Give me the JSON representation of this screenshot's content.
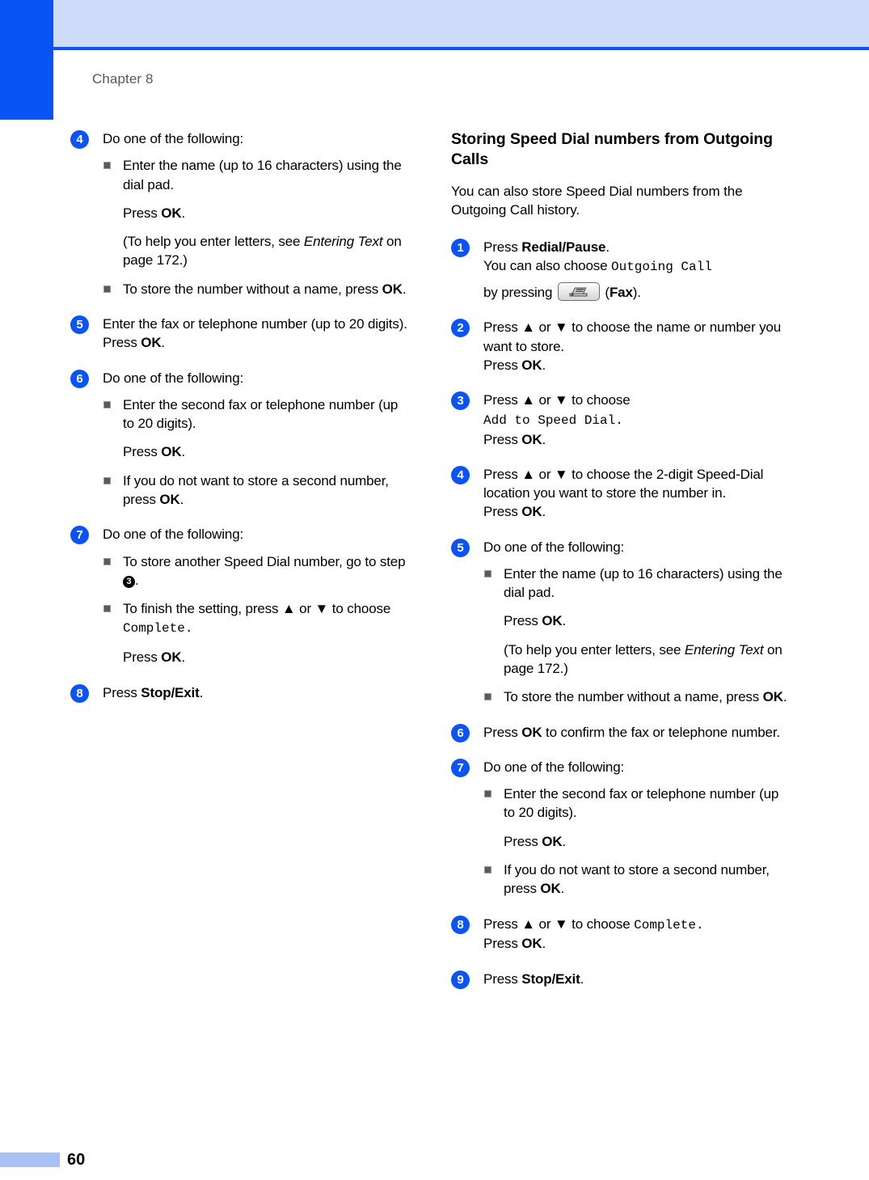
{
  "header": {
    "chapter_label": "Chapter 8"
  },
  "footer": {
    "page_number": "60"
  },
  "left_column": {
    "steps": [
      {
        "number": "4",
        "lines": [
          "Do one of the following:"
        ],
        "items": [
          {
            "kind": "bullet",
            "text_a": "Enter the name (up to 16 characters) using the dial pad."
          },
          {
            "kind": "para",
            "press": "Press ",
            "bold": "OK",
            "tail": "."
          },
          {
            "kind": "para",
            "text": " (To help you enter letters, see ",
            "italic": "Entering Text",
            "tail": " on page 172.)"
          },
          {
            "kind": "bullet",
            "text_a": "To store the number without a name, press ",
            "bold": "OK",
            "tail": "."
          }
        ]
      },
      {
        "number": "5",
        "lines": [
          "Enter the fax or telephone number (up to 20 digits)."
        ],
        "press_line": "Press ",
        "press_bold": "OK",
        "press_tail": "."
      },
      {
        "number": "6",
        "lines": [
          "Do one of the following:"
        ],
        "items": [
          {
            "kind": "bullet",
            "text_a": "Enter the second fax or telephone number (up to 20 digits)."
          },
          {
            "kind": "para",
            "press": "Press ",
            "bold": "OK",
            "tail": "."
          },
          {
            "kind": "bullet",
            "text_a": "If you do not want to store a second number, press ",
            "bold": "OK",
            "tail": "."
          }
        ]
      },
      {
        "number": "7",
        "lines": [
          "Do one of the following:"
        ],
        "items": [
          {
            "kind": "bullet_ref",
            "text_a": "To store another Speed Dial number, go to step ",
            "ref": "3",
            "tail": "."
          },
          {
            "kind": "bullet_lcd",
            "text_a": "To finish the setting, press ▲ or ▼ to choose ",
            "lcd": "Complete",
            "tail": "."
          },
          {
            "kind": "para",
            "press": "Press ",
            "bold": "OK",
            "tail": "."
          }
        ]
      },
      {
        "number": "8",
        "press_only": "Press ",
        "press_bold": "Stop/Exit",
        "press_tail": "."
      }
    ]
  },
  "right_column": {
    "heading": "Storing Speed Dial numbers from Outgoing Calls",
    "intro": "You can also store Speed Dial numbers from the Outgoing Call history.",
    "steps": [
      {
        "number": "1",
        "l1_press": "Press ",
        "l1_bold": "Redial/Pause",
        "l1_tail": ".",
        "l2_text": "You can also choose ",
        "l2_lcd": "Outgoing Call",
        "l3_text": "by pressing ",
        "l3_icon": "fax-machine-icon",
        "l3_paren_open": " (",
        "l3_bold": "Fax",
        "l3_paren_close": ")."
      },
      {
        "number": "2",
        "line1": "Press ▲ or ▼ to choose the name or number you want to store.",
        "press": "Press ",
        "press_bold": "OK",
        "press_tail": "."
      },
      {
        "number": "3",
        "line1": "Press ▲ or ▼ to choose",
        "lcd": "Add to Speed Dial",
        "lcd_tail": ".",
        "press": "Press ",
        "press_bold": "OK",
        "press_tail": "."
      },
      {
        "number": "4",
        "line1": "Press ▲ or ▼ to choose the 2-digit Speed-Dial location you want to store the number in.",
        "press": "Press ",
        "press_bold": "OK",
        "press_tail": "."
      },
      {
        "number": "5",
        "line1": "Do one of the following:",
        "items": [
          {
            "kind": "bullet",
            "text_a": "Enter the name (up to 16 characters) using the dial pad."
          },
          {
            "kind": "para",
            "press": "Press ",
            "bold": "OK",
            "tail": "."
          },
          {
            "kind": "para",
            "text": "(To help you enter letters, see ",
            "italic": "Entering Text",
            "tail": " on page 172.)"
          },
          {
            "kind": "bullet",
            "text_a": "To store the number without a name, press ",
            "bold": "OK",
            "tail": "."
          }
        ]
      },
      {
        "number": "6",
        "press": "Press ",
        "press_bold": "OK",
        "press_tail": " to confirm the fax or telephone number."
      },
      {
        "number": "7",
        "line1": "Do one of the following:",
        "items": [
          {
            "kind": "bullet",
            "text_a": "Enter the second fax or telephone number (up to 20 digits)."
          },
          {
            "kind": "para",
            "press": "Press ",
            "bold": "OK",
            "tail": "."
          },
          {
            "kind": "bullet",
            "text_a": "If you do not want to store a second number, press ",
            "bold": "OK",
            "tail": "."
          }
        ]
      },
      {
        "number": "8",
        "line1_a": "Press ▲ or ▼ to  choose ",
        "line1_lcd": "Complete",
        "line1_tail": ".",
        "press": "Press ",
        "press_bold": "OK",
        "press_tail": "."
      },
      {
        "number": "9",
        "press": "Press ",
        "press_bold": "Stop/Exit",
        "press_tail": "."
      }
    ]
  }
}
